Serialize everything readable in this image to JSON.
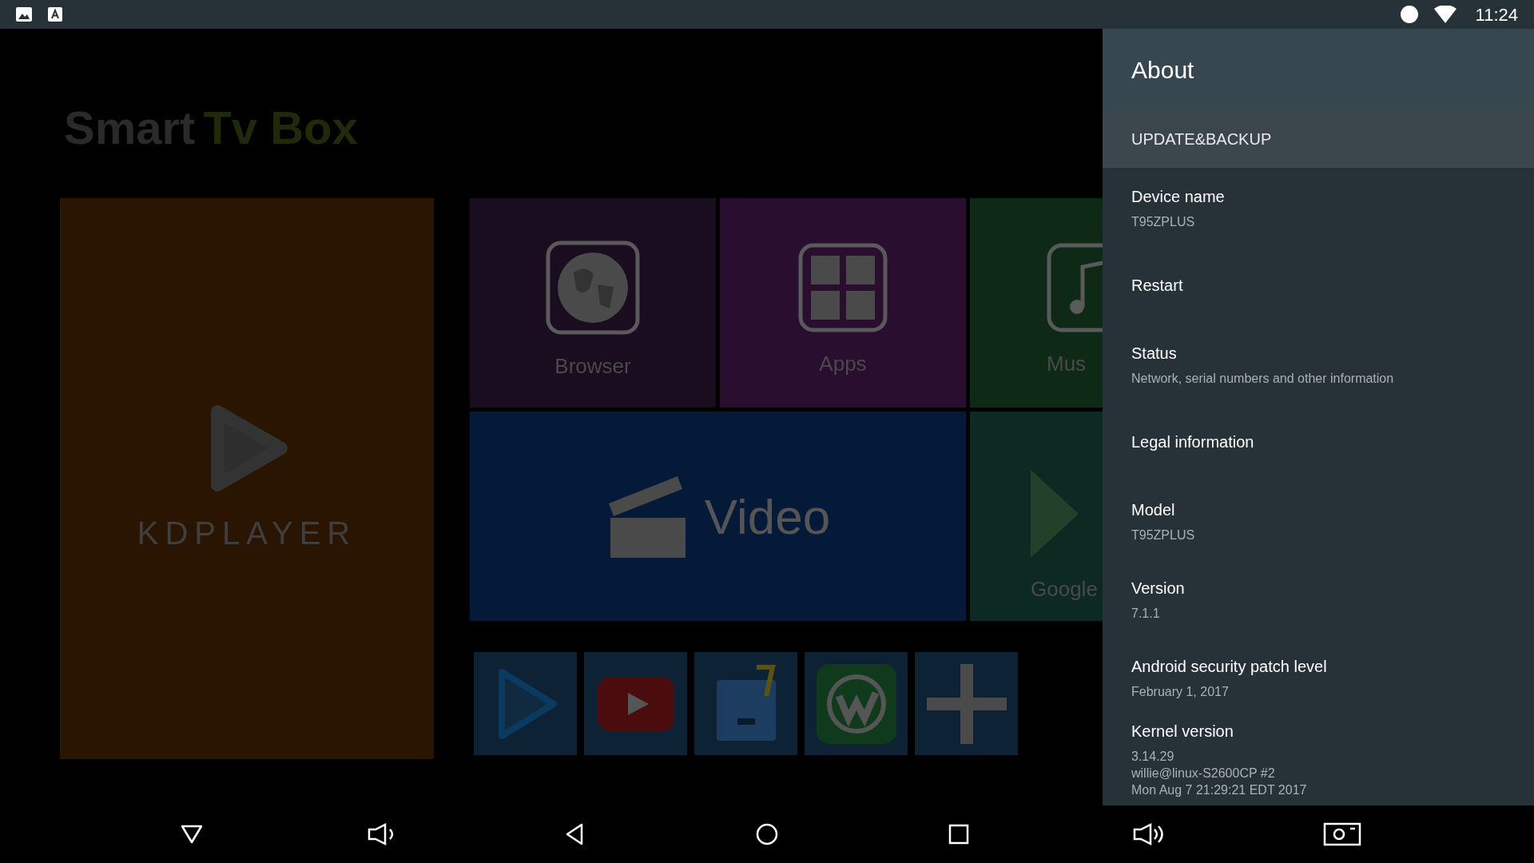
{
  "status_bar": {
    "time": "11:24"
  },
  "launcher": {
    "logo": {
      "first": "Smart",
      "second": "Tv Box"
    },
    "feature_tile": {
      "label": "KDPLAYER"
    },
    "tiles": [
      {
        "label": "Browser",
        "kind": "globe"
      },
      {
        "label": "Apps",
        "kind": "grid"
      },
      {
        "label": "Mus",
        "kind": "music"
      },
      {
        "label": "Video",
        "kind": "clapper"
      },
      {
        "label": "Google",
        "kind": "play"
      }
    ],
    "shortcuts": [
      {
        "kind": "player"
      },
      {
        "kind": "youtube"
      },
      {
        "kind": "files"
      },
      {
        "kind": "w"
      },
      {
        "kind": "add"
      }
    ]
  },
  "panel": {
    "title": "About",
    "items": [
      {
        "title": "UPDATE&BACKUP",
        "kind": "header",
        "selected": true
      },
      {
        "title": "Device name",
        "summary": [
          "T95ZPLUS"
        ],
        "kind": "item",
        "selected": false
      },
      {
        "title": "Restart",
        "kind": "item",
        "selected": false
      },
      {
        "title": "Status",
        "summary": [
          "Network, serial numbers and other information"
        ],
        "kind": "item",
        "selected": false
      },
      {
        "title": "Legal information",
        "kind": "item",
        "selected": false
      },
      {
        "title": "Model",
        "summary": [
          "T95ZPLUS"
        ],
        "kind": "item",
        "selected": false
      },
      {
        "title": "Version",
        "summary": [
          "7.1.1"
        ],
        "kind": "item",
        "selected": false
      },
      {
        "title": "Android security patch level",
        "summary": [
          "February 1, 2017"
        ],
        "kind": "item",
        "selected": false
      },
      {
        "title": "Kernel version",
        "summary": [
          "3.14.29",
          "willie@linux-S2600CP #2",
          "Mon Aug 7 21:29:21 EDT 2017"
        ],
        "kind": "item",
        "selected": false
      }
    ]
  }
}
